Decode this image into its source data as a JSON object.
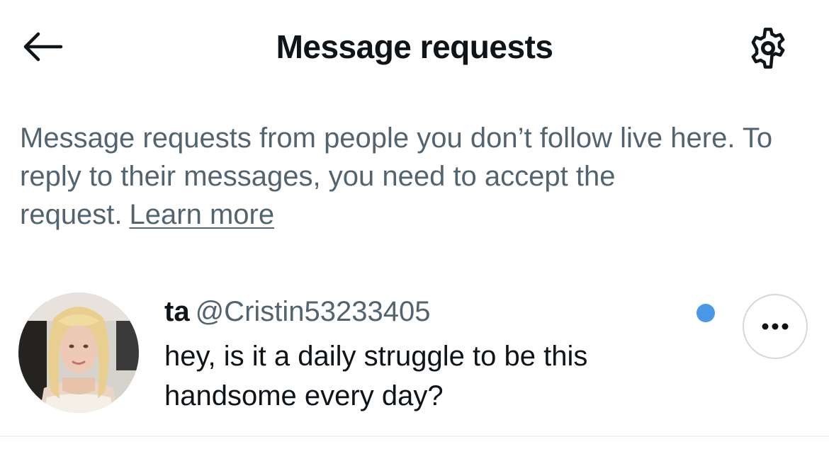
{
  "header": {
    "title": "Message requests",
    "back_icon": "arrow-left-icon",
    "settings_icon": "gear-icon"
  },
  "info": {
    "text": "Message requests from people you don’t follow live here. To reply to their messages, you need to accept the request.",
    "link_label": "Learn more"
  },
  "requests": [
    {
      "display_name": "ta",
      "handle": "@Cristin53233405",
      "message": "hey, is it a daily struggle to be this handsome every day?",
      "unread": true,
      "more_icon": "ellipsis-icon"
    }
  ],
  "colors": {
    "text_primary": "#0f1419",
    "text_secondary": "#536471",
    "unread_dot": "#4a99e9",
    "border": "#cfd9de"
  }
}
